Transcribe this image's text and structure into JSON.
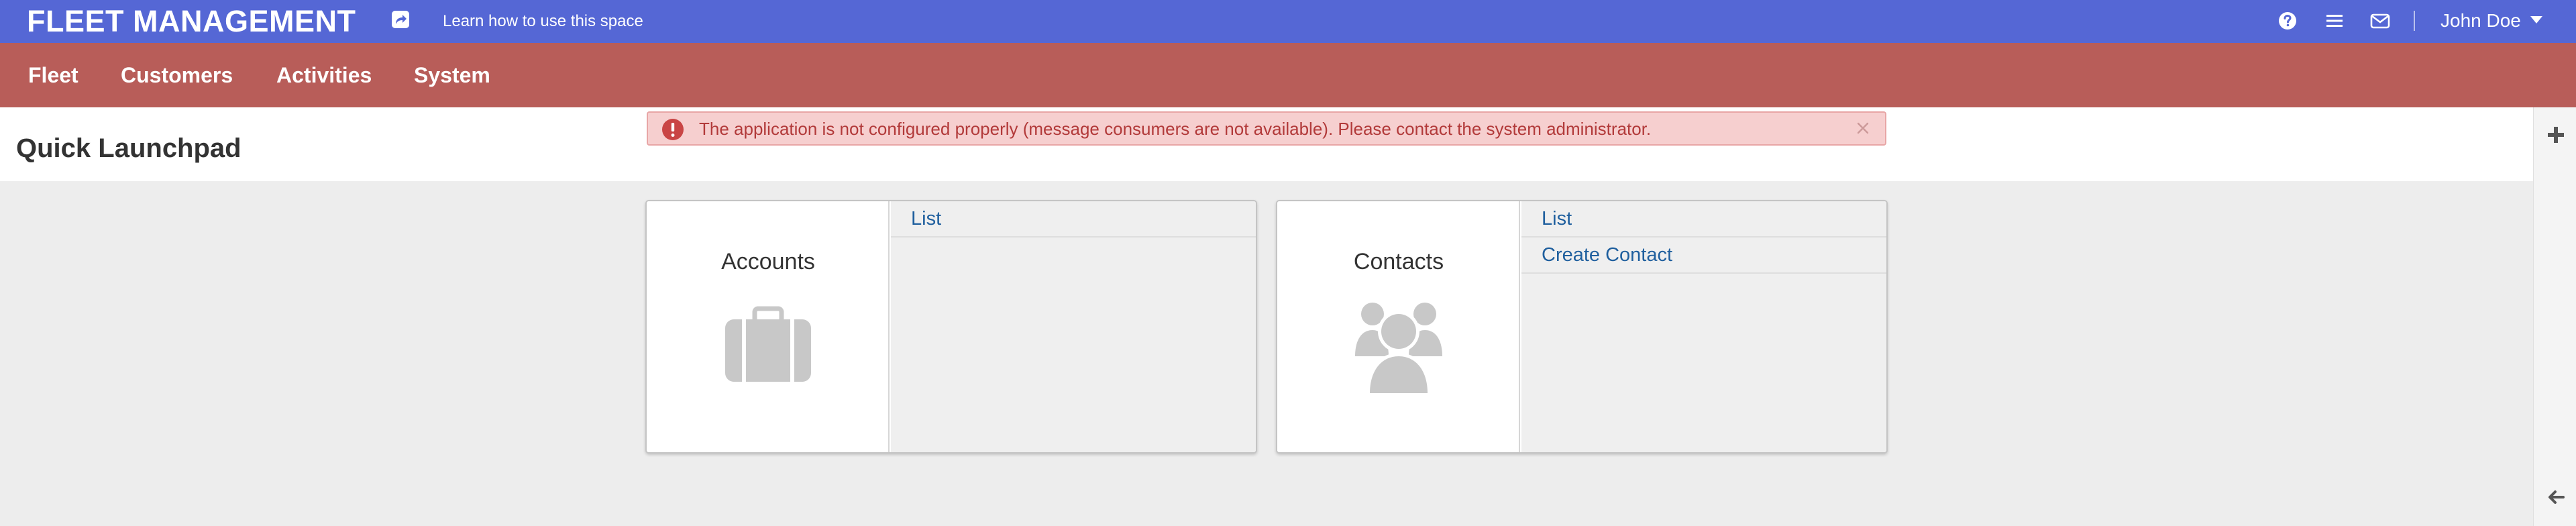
{
  "header": {
    "brand": "FLEET MANAGEMENT",
    "learn_link": "Learn how to use this space",
    "user_name": "John Doe"
  },
  "icons": {
    "share": "share-icon",
    "help": "question-circle-icon",
    "menu": "list-icon",
    "mail": "envelope-icon",
    "caret": "caret-down-icon",
    "alert": "exclamation-circle-icon",
    "close": "close-icon",
    "plus": "plus-icon",
    "collapse": "arrow-left-icon",
    "accounts": "briefcase-icon",
    "contacts": "users-icon"
  },
  "nav": {
    "items": [
      "Fleet",
      "Customers",
      "Activities",
      "System"
    ]
  },
  "page": {
    "title": "Quick Launchpad"
  },
  "alert": {
    "text": "The application is not configured properly (message consumers are not available). Please contact the system administrator."
  },
  "cards": [
    {
      "title": "Accounts",
      "links": [
        "List"
      ]
    },
    {
      "title": "Contacts",
      "links": [
        "List",
        "Create Contact"
      ]
    }
  ],
  "colors": {
    "topbar": "#5567d5",
    "mainnav": "#b85d59",
    "alert_bg": "#f6cfcf",
    "alert_text": "#b23a3a",
    "link": "#1f5f9e",
    "icon_gray": "#c8c8c8"
  }
}
